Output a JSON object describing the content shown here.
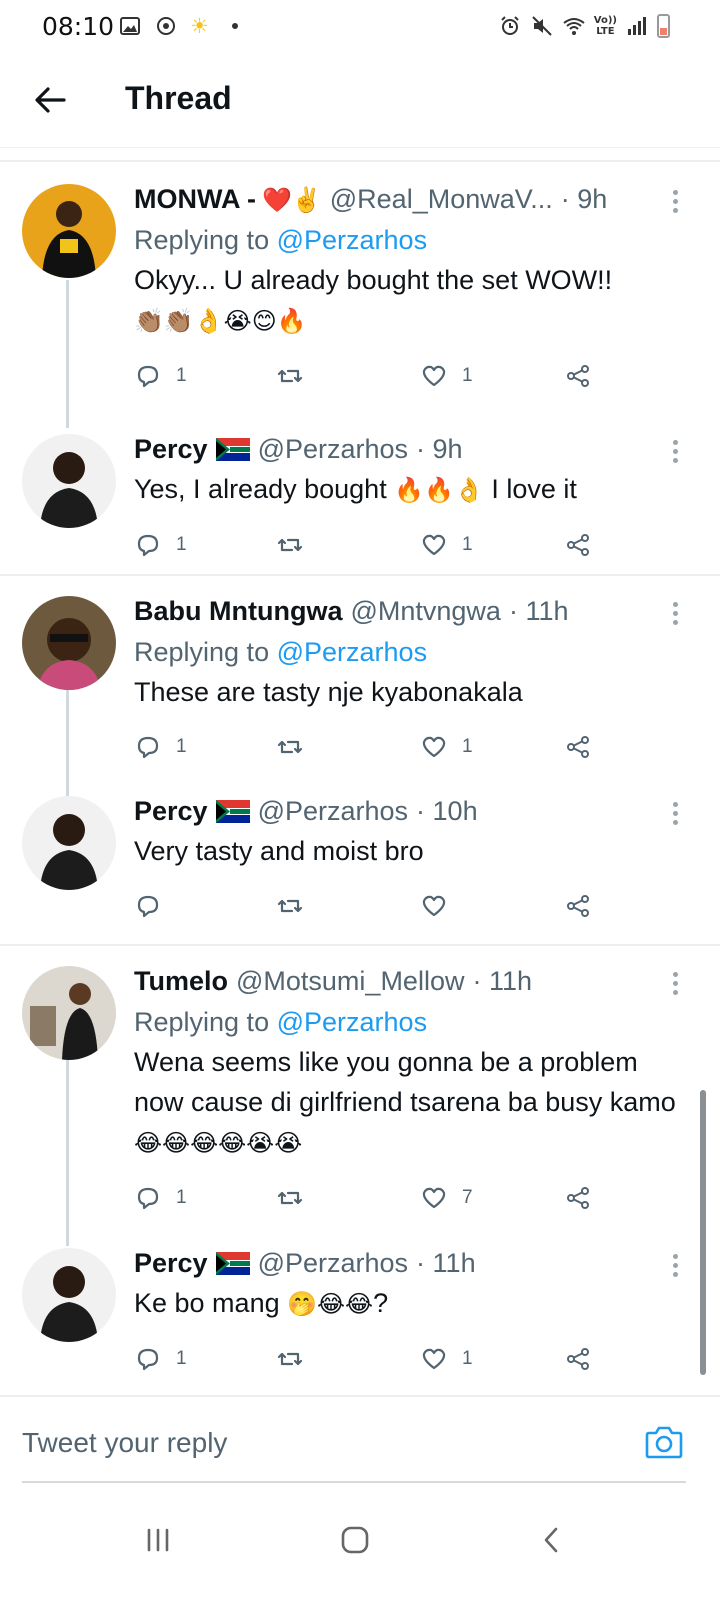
{
  "status_bar": {
    "time": "08:10",
    "network_label_top": "Vo))",
    "network_label_bottom": "LTE"
  },
  "header": {
    "title": "Thread"
  },
  "tweets": [
    {
      "name": "MONWA -",
      "name_emoji": "❤️✌️",
      "handle": "@Real_MonwaV...",
      "time": "· 9h",
      "replying_prefix": "Replying to",
      "replying_to": "@Perzarhos",
      "text": "Okyy... U already bought the set WOW!!",
      "emojis": "👏🏽👏🏽👌😭😊🔥",
      "replies": "1",
      "retweets": "",
      "likes": "1"
    },
    {
      "name": "Percy",
      "flag": "ZA",
      "handle": "@Perzarhos",
      "time": "· 9h",
      "text": "Yes, I already bought",
      "emojis": "🔥🔥👌",
      "text_after": "I love it",
      "replies": "1",
      "retweets": "",
      "likes": "1"
    },
    {
      "name": "Babu Mntungwa",
      "handle": "@Mntvngwa",
      "time": "· 11h",
      "replying_prefix": "Replying to",
      "replying_to": "@Perzarhos",
      "text": "These are tasty nje kyabonakala",
      "replies": "1",
      "retweets": "",
      "likes": "1"
    },
    {
      "name": "Percy",
      "flag": "ZA",
      "handle": "@Perzarhos",
      "time": "· 10h",
      "text": "Very tasty and moist bro",
      "replies": "",
      "retweets": "",
      "likes": ""
    },
    {
      "name": "Tumelo",
      "handle": "@Motsumi_Mellow",
      "time": "· 11h",
      "replying_prefix": "Replying to",
      "replying_to": "@Perzarhos",
      "text": "Wena seems like you gonna be a problem now cause di girlfriend tsarena ba busy kamo",
      "emojis": "😂😂😂😂😭😭",
      "replies": "1",
      "retweets": "",
      "likes": "7"
    },
    {
      "name": "Percy",
      "flag": "ZA",
      "handle": "@Perzarhos",
      "time": "· 11h",
      "text": "Ke bo mang",
      "emojis": "🤭😂😂",
      "text_after": "?",
      "replies": "1",
      "retweets": "",
      "likes": "1"
    }
  ],
  "reply_bar": {
    "placeholder": "Tweet your reply"
  },
  "colors": {
    "link": "#1d9bf0",
    "secondary_text": "#536471",
    "thread_line": "#cfd9de"
  }
}
